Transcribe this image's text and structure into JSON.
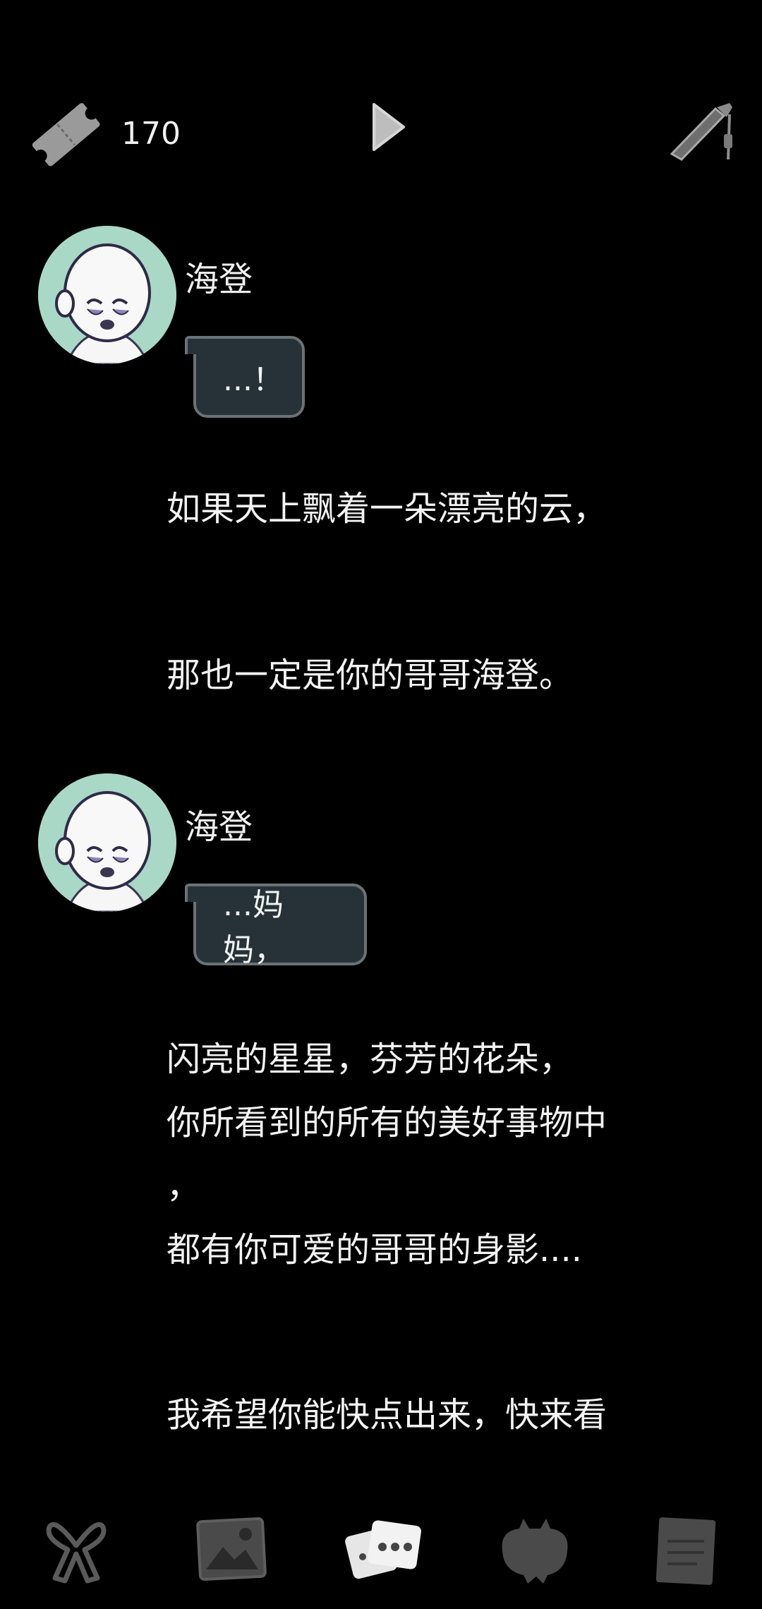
{
  "topbar": {
    "ticket_icon": "ticket-icon",
    "ticket_count": "170",
    "play_icon": "play-icon",
    "pen_icon": "pen-icon"
  },
  "chat": {
    "messages": [
      {
        "speaker": "海登",
        "text": "...！"
      },
      {
        "speaker": "海登",
        "text": "...妈妈，"
      }
    ],
    "narrations": [
      "如果天上飘着一朵漂亮的云，",
      "那也一定是你的哥哥海登。",
      "闪亮的星星，芬芳的花朵，",
      "你所看到的所有的美好事物中",
      "，",
      "都有你可爱的哥哥的身影....",
      "我希望你能快点出来，快来看"
    ]
  },
  "bottomnav": {
    "items": [
      "ribbon-icon",
      "gallery-icon",
      "chat-cards-icon",
      "monster-icon",
      "notes-icon"
    ],
    "active": "chat-cards-icon"
  },
  "colors": {
    "background": "#000000",
    "bubble_fill": "#263237",
    "bubble_border": "#6a7276",
    "avatar_bg": "#a9d8c7"
  }
}
